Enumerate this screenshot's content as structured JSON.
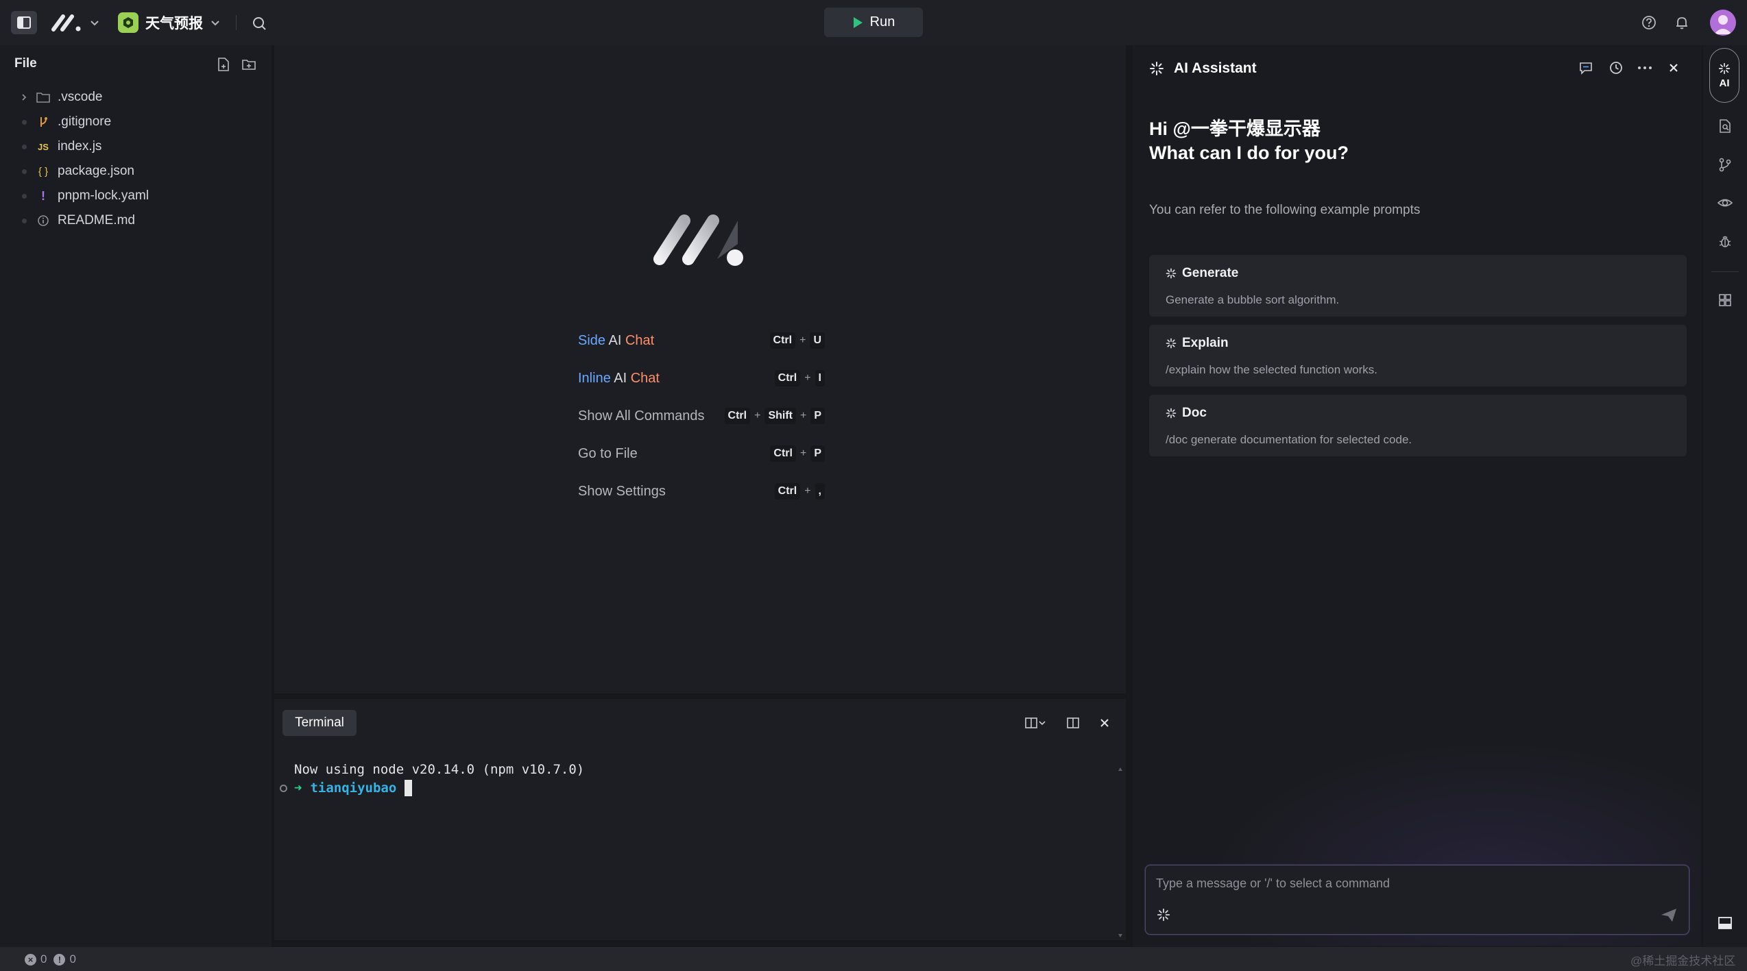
{
  "topbar": {
    "project_name": "天气预报",
    "run_label": "Run"
  },
  "explorer": {
    "title": "File",
    "items": [
      {
        "name": ".vscode",
        "type": "folder"
      },
      {
        "name": ".gitignore",
        "type": "git"
      },
      {
        "name": "index.js",
        "type": "js",
        "icon_text": "JS"
      },
      {
        "name": "package.json",
        "type": "json",
        "icon_text": "{ }"
      },
      {
        "name": "pnpm-lock.yaml",
        "type": "yaml",
        "icon_text": "!"
      },
      {
        "name": "README.md",
        "type": "info"
      }
    ]
  },
  "welcome": {
    "side_chat": {
      "w1": "Side",
      "w2": "AI",
      "w3": "Chat",
      "keys": [
        "Ctrl",
        "U"
      ]
    },
    "inline_chat": {
      "w1": "Inline",
      "w2": "AI",
      "w3": "Chat",
      "keys": [
        "Ctrl",
        "I"
      ]
    },
    "commands": [
      {
        "label": "Show All Commands",
        "keys": [
          "Ctrl",
          "Shift",
          "P"
        ]
      },
      {
        "label": "Go to File",
        "keys": [
          "Ctrl",
          "P"
        ]
      },
      {
        "label": "Show Settings",
        "keys": [
          "Ctrl",
          ","
        ]
      }
    ],
    "plus": "+"
  },
  "terminal": {
    "tab_label": "Terminal",
    "line1": "Now using node v20.14.0 (npm v10.7.0)",
    "arrow": "➜",
    "cwd": "tianqiyubao"
  },
  "ai": {
    "title": "AI Assistant",
    "greeting": "Hi @一拳干爆显示器",
    "question": "What can I do for you?",
    "hint": "You can refer to the following example prompts",
    "prompts": [
      {
        "title": "Generate",
        "desc": "Generate a bubble sort algorithm."
      },
      {
        "title": "Explain",
        "desc": "/explain how the selected function works."
      },
      {
        "title": "Doc",
        "desc": "/doc generate documentation for selected code."
      }
    ],
    "input_placeholder": "Type a message or '/' to select a command"
  },
  "activity": {
    "ai_label": "AI"
  },
  "status": {
    "errors": "0",
    "warnings": "0"
  },
  "watermark": "@稀土掘金技术社区",
  "colors": {
    "accent_green": "#9ad055",
    "terminal_arrow": "#28d38a",
    "terminal_cwd": "#34b3e4",
    "side_blue": "#6aa7ff",
    "chat_orange": "#ff8f6a"
  }
}
